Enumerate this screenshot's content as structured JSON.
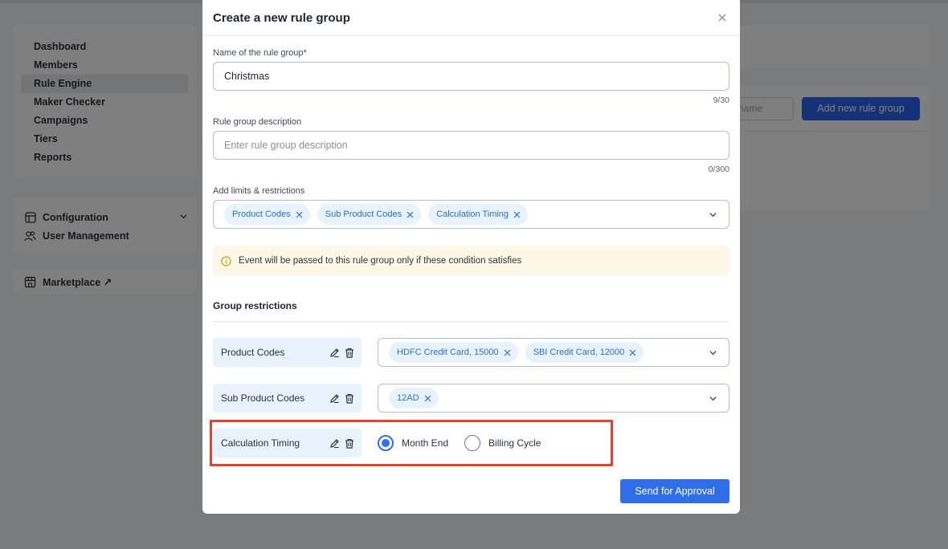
{
  "sidebar": {
    "nav_items": [
      {
        "label": "Dashboard"
      },
      {
        "label": "Members"
      },
      {
        "label": "Rule Engine",
        "active": true
      },
      {
        "label": "Maker Checker"
      },
      {
        "label": "Campaigns"
      },
      {
        "label": "Tiers"
      },
      {
        "label": "Reports"
      }
    ],
    "configuration_label": "Configuration",
    "user_management_label": "User Management",
    "marketplace_label": "Marketplace ↗"
  },
  "background": {
    "search_placeholder": "name",
    "add_button_label": "Add new rule group"
  },
  "modal": {
    "title": "Create a new rule group",
    "name_label": "Name of the rule group*",
    "name_value": "Christmas",
    "name_counter": "9/30",
    "description_label": "Rule group description",
    "description_placeholder": "Enter rule group description",
    "description_counter": "0/300",
    "limits_label": "Add limits & restrictions",
    "limits_chips": [
      "Product Codes",
      "Sub Product Codes",
      "Calculation Timing"
    ],
    "info_text": "Event will be passed to this rule group only if these condition satisfies",
    "group_restrictions_title": "Group restrictions",
    "restrictions": [
      {
        "label": "Product Codes",
        "chips": [
          "HDFC Credit Card, 15000",
          "SBI Credit Card, 12000"
        ]
      },
      {
        "label": "Sub Product Codes",
        "chips": [
          "12AD"
        ]
      },
      {
        "label": "Calculation Timing",
        "radio_options": [
          {
            "label": "Month End",
            "selected": true
          },
          {
            "label": "Billing Cycle",
            "selected": false
          }
        ]
      }
    ],
    "submit_label": "Send for Approval"
  },
  "colors": {
    "primary": "#2f6ee8",
    "chip_bg": "#e8f2fc",
    "chip_text": "#2d6ed6",
    "info_bg": "#fcf7e6",
    "highlight": "#e8402a"
  }
}
